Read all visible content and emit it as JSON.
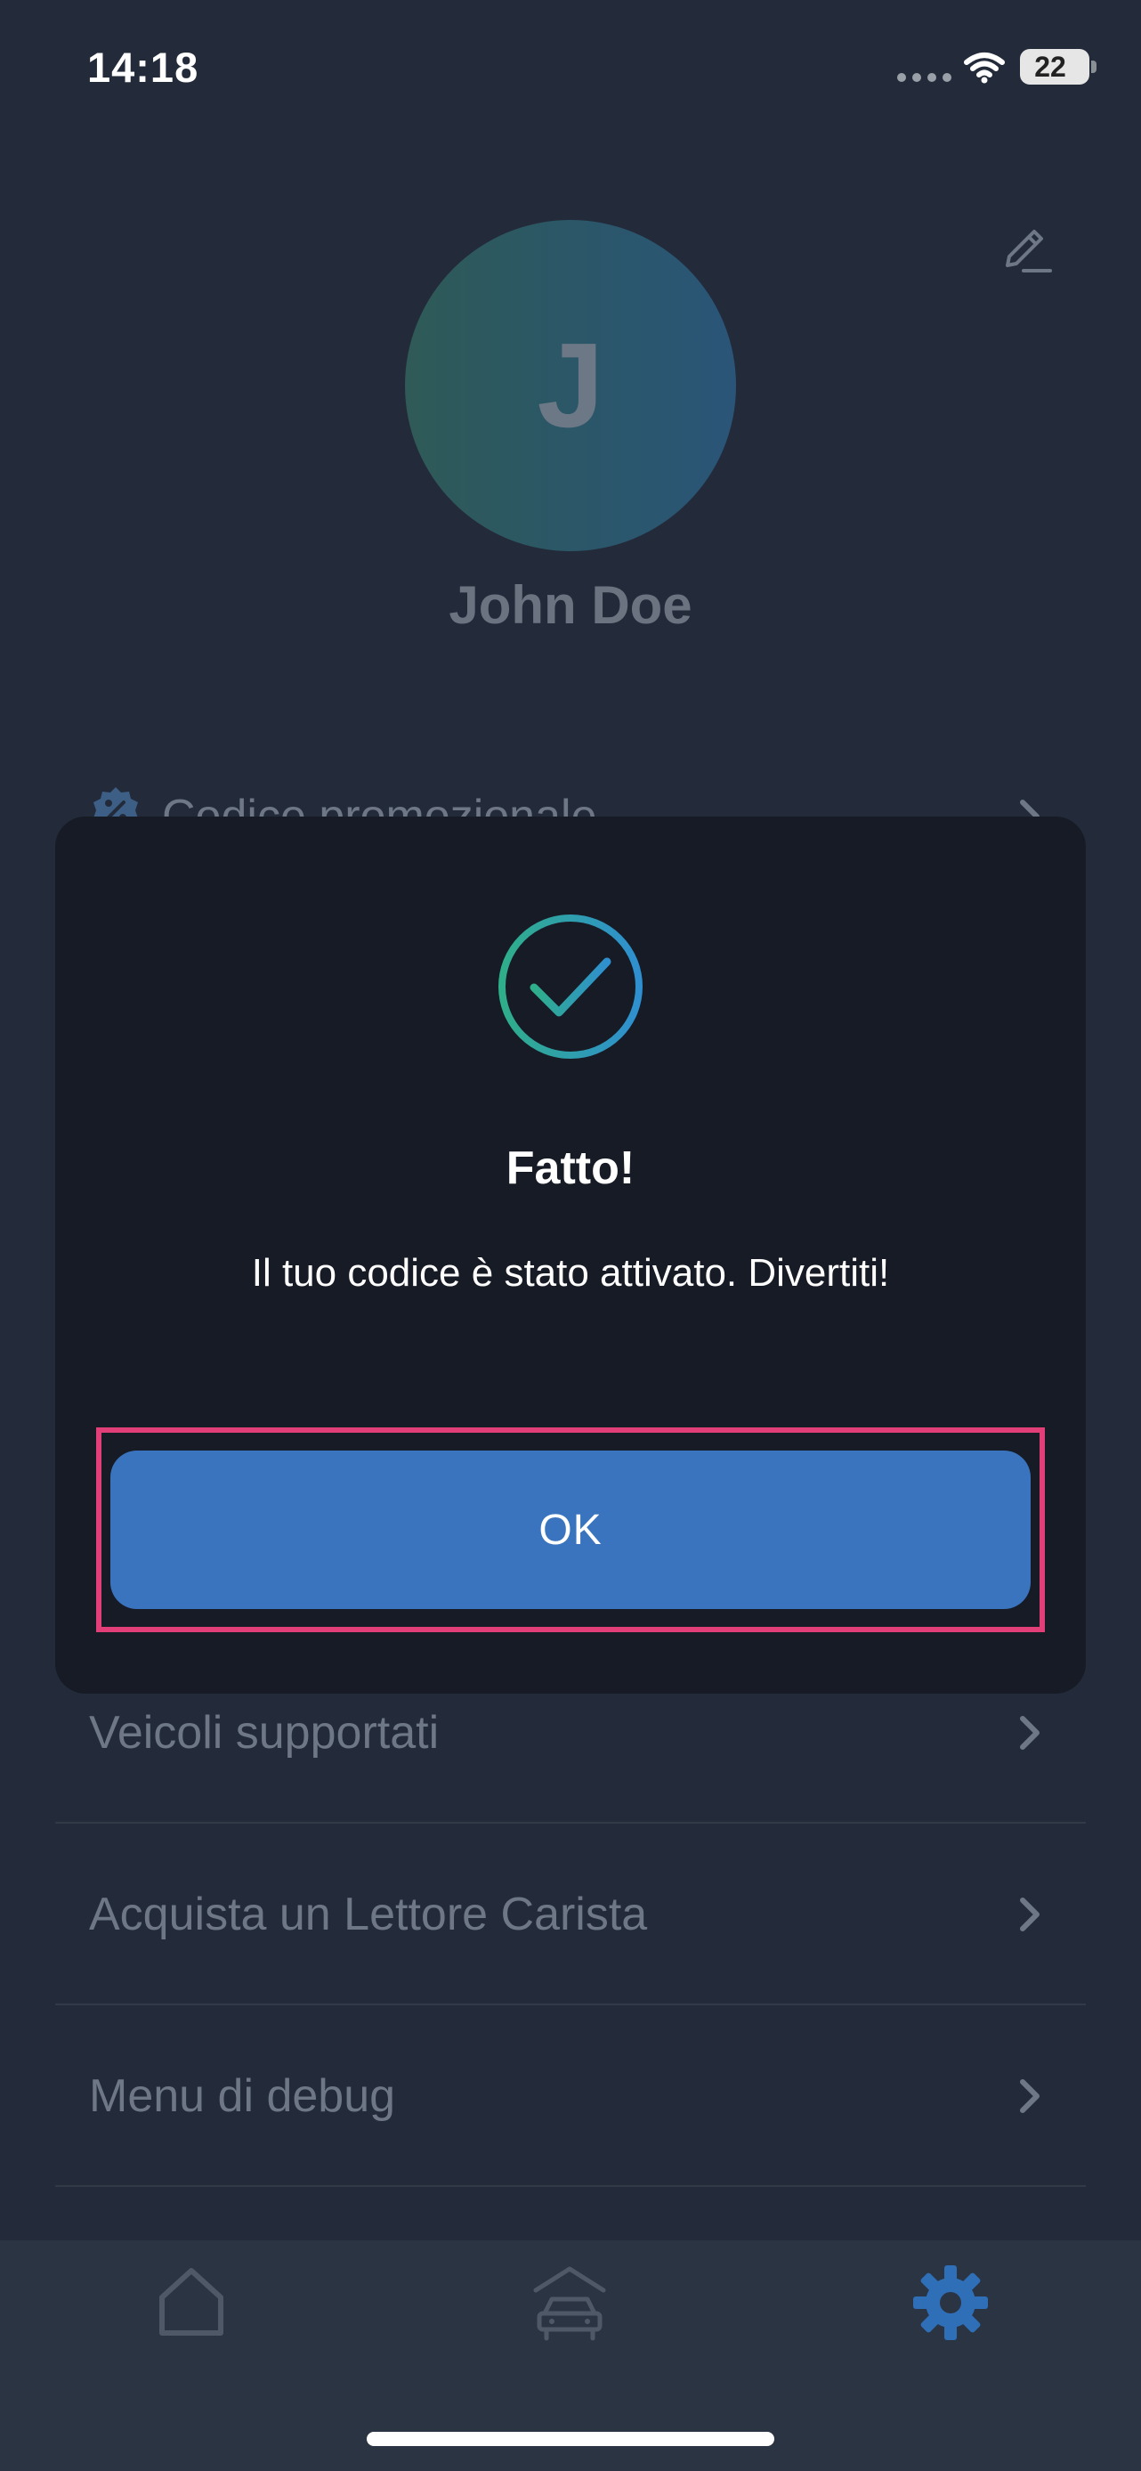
{
  "status_bar": {
    "time": "14:18",
    "battery_level": "22",
    "icons": [
      "signal-dots-icon",
      "wifi-icon",
      "battery-icon"
    ]
  },
  "profile": {
    "avatar_initial": "J",
    "name": "John Doe",
    "edit_icon": "pencil-icon"
  },
  "menu": {
    "items": [
      {
        "label": "Codice promozionale",
        "icon": "promo-badge-icon"
      },
      {
        "label": "Veicoli supportati"
      },
      {
        "label": "Acquista un Lettore Carista"
      },
      {
        "label": "Menu di debug"
      }
    ],
    "chevron_icon": "chevron-right-icon"
  },
  "tab_bar": {
    "tabs": [
      {
        "name": "home",
        "icon": "home-icon",
        "active": false
      },
      {
        "name": "garage",
        "icon": "car-garage-icon",
        "active": false
      },
      {
        "name": "settings",
        "icon": "gear-icon",
        "active": true
      }
    ]
  },
  "dialog": {
    "icon": "check-circle-icon",
    "title": "Fatto!",
    "message": "Il tuo codice è stato attivato. Divertiti!",
    "ok_label": "OK"
  },
  "colors": {
    "background": "#232b3a",
    "dialog_background": "#171b26",
    "button_primary": "#3a74bf",
    "highlight_border": "#e23f78",
    "check_gradient_start": "#2fae8a",
    "check_gradient_end": "#2f8fd0",
    "active_tab": "#2e6fb8",
    "inactive_tab": "#4f5866"
  }
}
